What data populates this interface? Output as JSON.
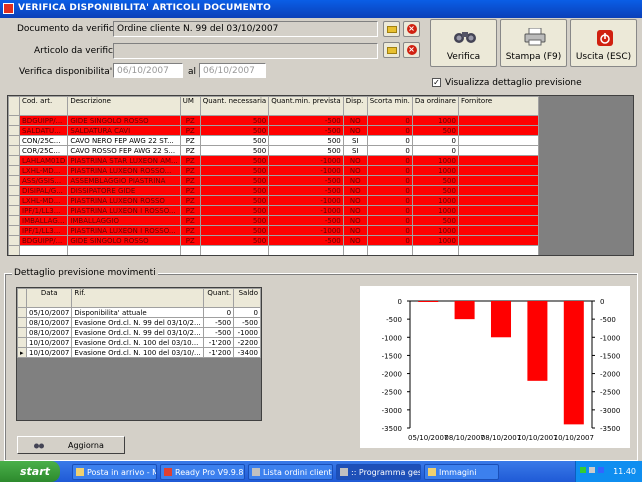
{
  "window": {
    "title": "VERIFICA DISPONIBILITA' ARTICOLI DOCUMENTO"
  },
  "form": {
    "documento_label": "Documento da verificare",
    "documento_value": "Ordine cliente N. 99 del 03/10/2007",
    "articolo_label": "Articolo da verificare",
    "articolo_value": "",
    "verifica_dal_label": "Verifica disponibilita' dal",
    "dal_value": "06/10/2007",
    "al_label": "al",
    "al_value": "06/10/2007",
    "dettaglio_checkbox_label": "Visualizza dettaglio previsione",
    "dettaglio_checked": true
  },
  "buttons": {
    "verifica": "Verifica",
    "stampa": "Stampa (F9)",
    "uscita": "Uscita (ESC)",
    "aggiorna": "Aggiorna"
  },
  "grid": {
    "headers": [
      "Cod. art.",
      "Descrizione",
      "UM",
      "Quant. necessaria",
      "Quant.min. prevista",
      "Disp.",
      "Scorta min.",
      "Da ordinare",
      "Fornitore"
    ],
    "rows": [
      {
        "cod": "BDGUIPP/...",
        "desc": "GIDE SINGOLO ROSSO",
        "um": "PZ",
        "qn": "500",
        "qp": "-500",
        "disp": "NO",
        "scorta": "0",
        "ord": "1000",
        "forn": "",
        "red": true
      },
      {
        "cod": "SALDATU...",
        "desc": "SALDATURA CAVI",
        "um": "PZ",
        "qn": "500",
        "qp": "-500",
        "disp": "NO",
        "scorta": "0",
        "ord": "500",
        "forn": "",
        "red": true
      },
      {
        "cod": "CON/25C...",
        "desc": "CAVO NERO FEP AWG 22 ST...",
        "um": "PZ",
        "qn": "500",
        "qp": "500",
        "disp": "SI",
        "scorta": "0",
        "ord": "0",
        "forn": "",
        "red": false
      },
      {
        "cod": "COR/25C...",
        "desc": "CAVO ROSSO FEP AWG 22 S...",
        "um": "PZ",
        "qn": "500",
        "qp": "500",
        "disp": "SI",
        "scorta": "0",
        "ord": "0",
        "forn": "",
        "red": false
      },
      {
        "cod": "LAHLAM01D",
        "desc": "PIASTRINA STAR LUXEON AM...",
        "um": "PZ",
        "qn": "500",
        "qp": "-1000",
        "disp": "NO",
        "scorta": "0",
        "ord": "1000",
        "forn": "",
        "red": true
      },
      {
        "cod": "LXHL-MD...",
        "desc": "PIASTRINA LUXEON ROSSO...",
        "um": "PZ",
        "qn": "500",
        "qp": "-1000",
        "disp": "NO",
        "scorta": "0",
        "ord": "1000",
        "forn": "",
        "red": true
      },
      {
        "cod": "ASS/GSIS...",
        "desc": "ASSEMBLAGGIO PIASTRINA",
        "um": "PZ",
        "qn": "500",
        "qp": "-500",
        "disp": "NO",
        "scorta": "0",
        "ord": "500",
        "forn": "",
        "red": true
      },
      {
        "cod": "DISIPAL/G...",
        "desc": "DISSIPATORE GIDE",
        "um": "PZ",
        "qn": "500",
        "qp": "-500",
        "disp": "NO",
        "scorta": "0",
        "ord": "500",
        "forn": "",
        "red": true
      },
      {
        "cod": "LXHL-MD...",
        "desc": "PIASTRINA LUXEON ROSSO",
        "um": "PZ",
        "qn": "500",
        "qp": "-1000",
        "disp": "NO",
        "scorta": "0",
        "ord": "1000",
        "forn": "",
        "red": true
      },
      {
        "cod": "IPF/1/LL3...",
        "desc": "PIASTRINA LUXEON I ROSSO...",
        "um": "PZ",
        "qn": "500",
        "qp": "-1000",
        "disp": "NO",
        "scorta": "0",
        "ord": "1000",
        "forn": "",
        "red": true
      },
      {
        "cod": "IMBALLAG...",
        "desc": "IMBALLAGGIO",
        "um": "PZ",
        "qn": "500",
        "qp": "-500",
        "disp": "NO",
        "scorta": "0",
        "ord": "500",
        "forn": "",
        "red": true
      },
      {
        "cod": "IPF/1/LL3...",
        "desc": "PIASTRINA LUXEON I ROSSO...",
        "um": "PZ",
        "qn": "500",
        "qp": "-1000",
        "disp": "NO",
        "scorta": "0",
        "ord": "1000",
        "forn": "",
        "red": true
      },
      {
        "cod": "BDGUIPP/...",
        "desc": "GIDE SINGOLO ROSSO",
        "um": "PZ",
        "qn": "500",
        "qp": "-500",
        "disp": "NO",
        "scorta": "0",
        "ord": "1000",
        "forn": "",
        "red": true
      }
    ]
  },
  "detail": {
    "group_title": "Dettaglio previsione movimenti",
    "headers": [
      "Data",
      "Rif.",
      "Quant.",
      "Saldo"
    ],
    "rows": [
      {
        "data": "05/10/2007",
        "rif": "Disponibilita' attuale",
        "quant": "0",
        "saldo": "0",
        "saldo_red": false,
        "selected": false
      },
      {
        "data": "08/10/2007",
        "rif": "Evasione Ord.cl. N. 99 del 03/10/2...",
        "quant": "-500",
        "saldo": "-500",
        "saldo_red": true,
        "selected": false
      },
      {
        "data": "08/10/2007",
        "rif": "Evasione Ord.cl. N. 99 del 03/10/2...",
        "quant": "-500",
        "saldo": "-1000",
        "saldo_red": true,
        "selected": false
      },
      {
        "data": "10/10/2007",
        "rif": "Evasione Ord.cl. N. 100 del 03/10...",
        "quant": "-1'200",
        "saldo": "-2200",
        "saldo_red": true,
        "selected": false
      },
      {
        "data": "10/10/2007",
        "rif": "Evasione Ord.cl. N. 100 del 03/10/...",
        "quant": "-1'200",
        "saldo": "-3400",
        "saldo_red": false,
        "selected": true
      }
    ]
  },
  "chart_data": {
    "type": "bar",
    "categories": [
      "05/10/2007",
      "08/10/2007",
      "08/10/2007",
      "10/10/2007",
      "10/10/2007"
    ],
    "values": [
      0,
      -500,
      -1000,
      -2200,
      -3400
    ],
    "ylim": [
      -3500,
      0
    ],
    "yticks": [
      0,
      -500,
      -1000,
      -1500,
      -2000,
      -2500,
      -3000,
      -3500
    ],
    "color": "#ff0000",
    "grid": false
  },
  "taskbar": {
    "start": "start",
    "tasks": [
      "Posta in arrivo - M...",
      "Ready Pro V9.9.8 ...",
      "Lista ordini clienti",
      ":: Programma gest...",
      "Immagini"
    ],
    "clock": "11.40"
  }
}
